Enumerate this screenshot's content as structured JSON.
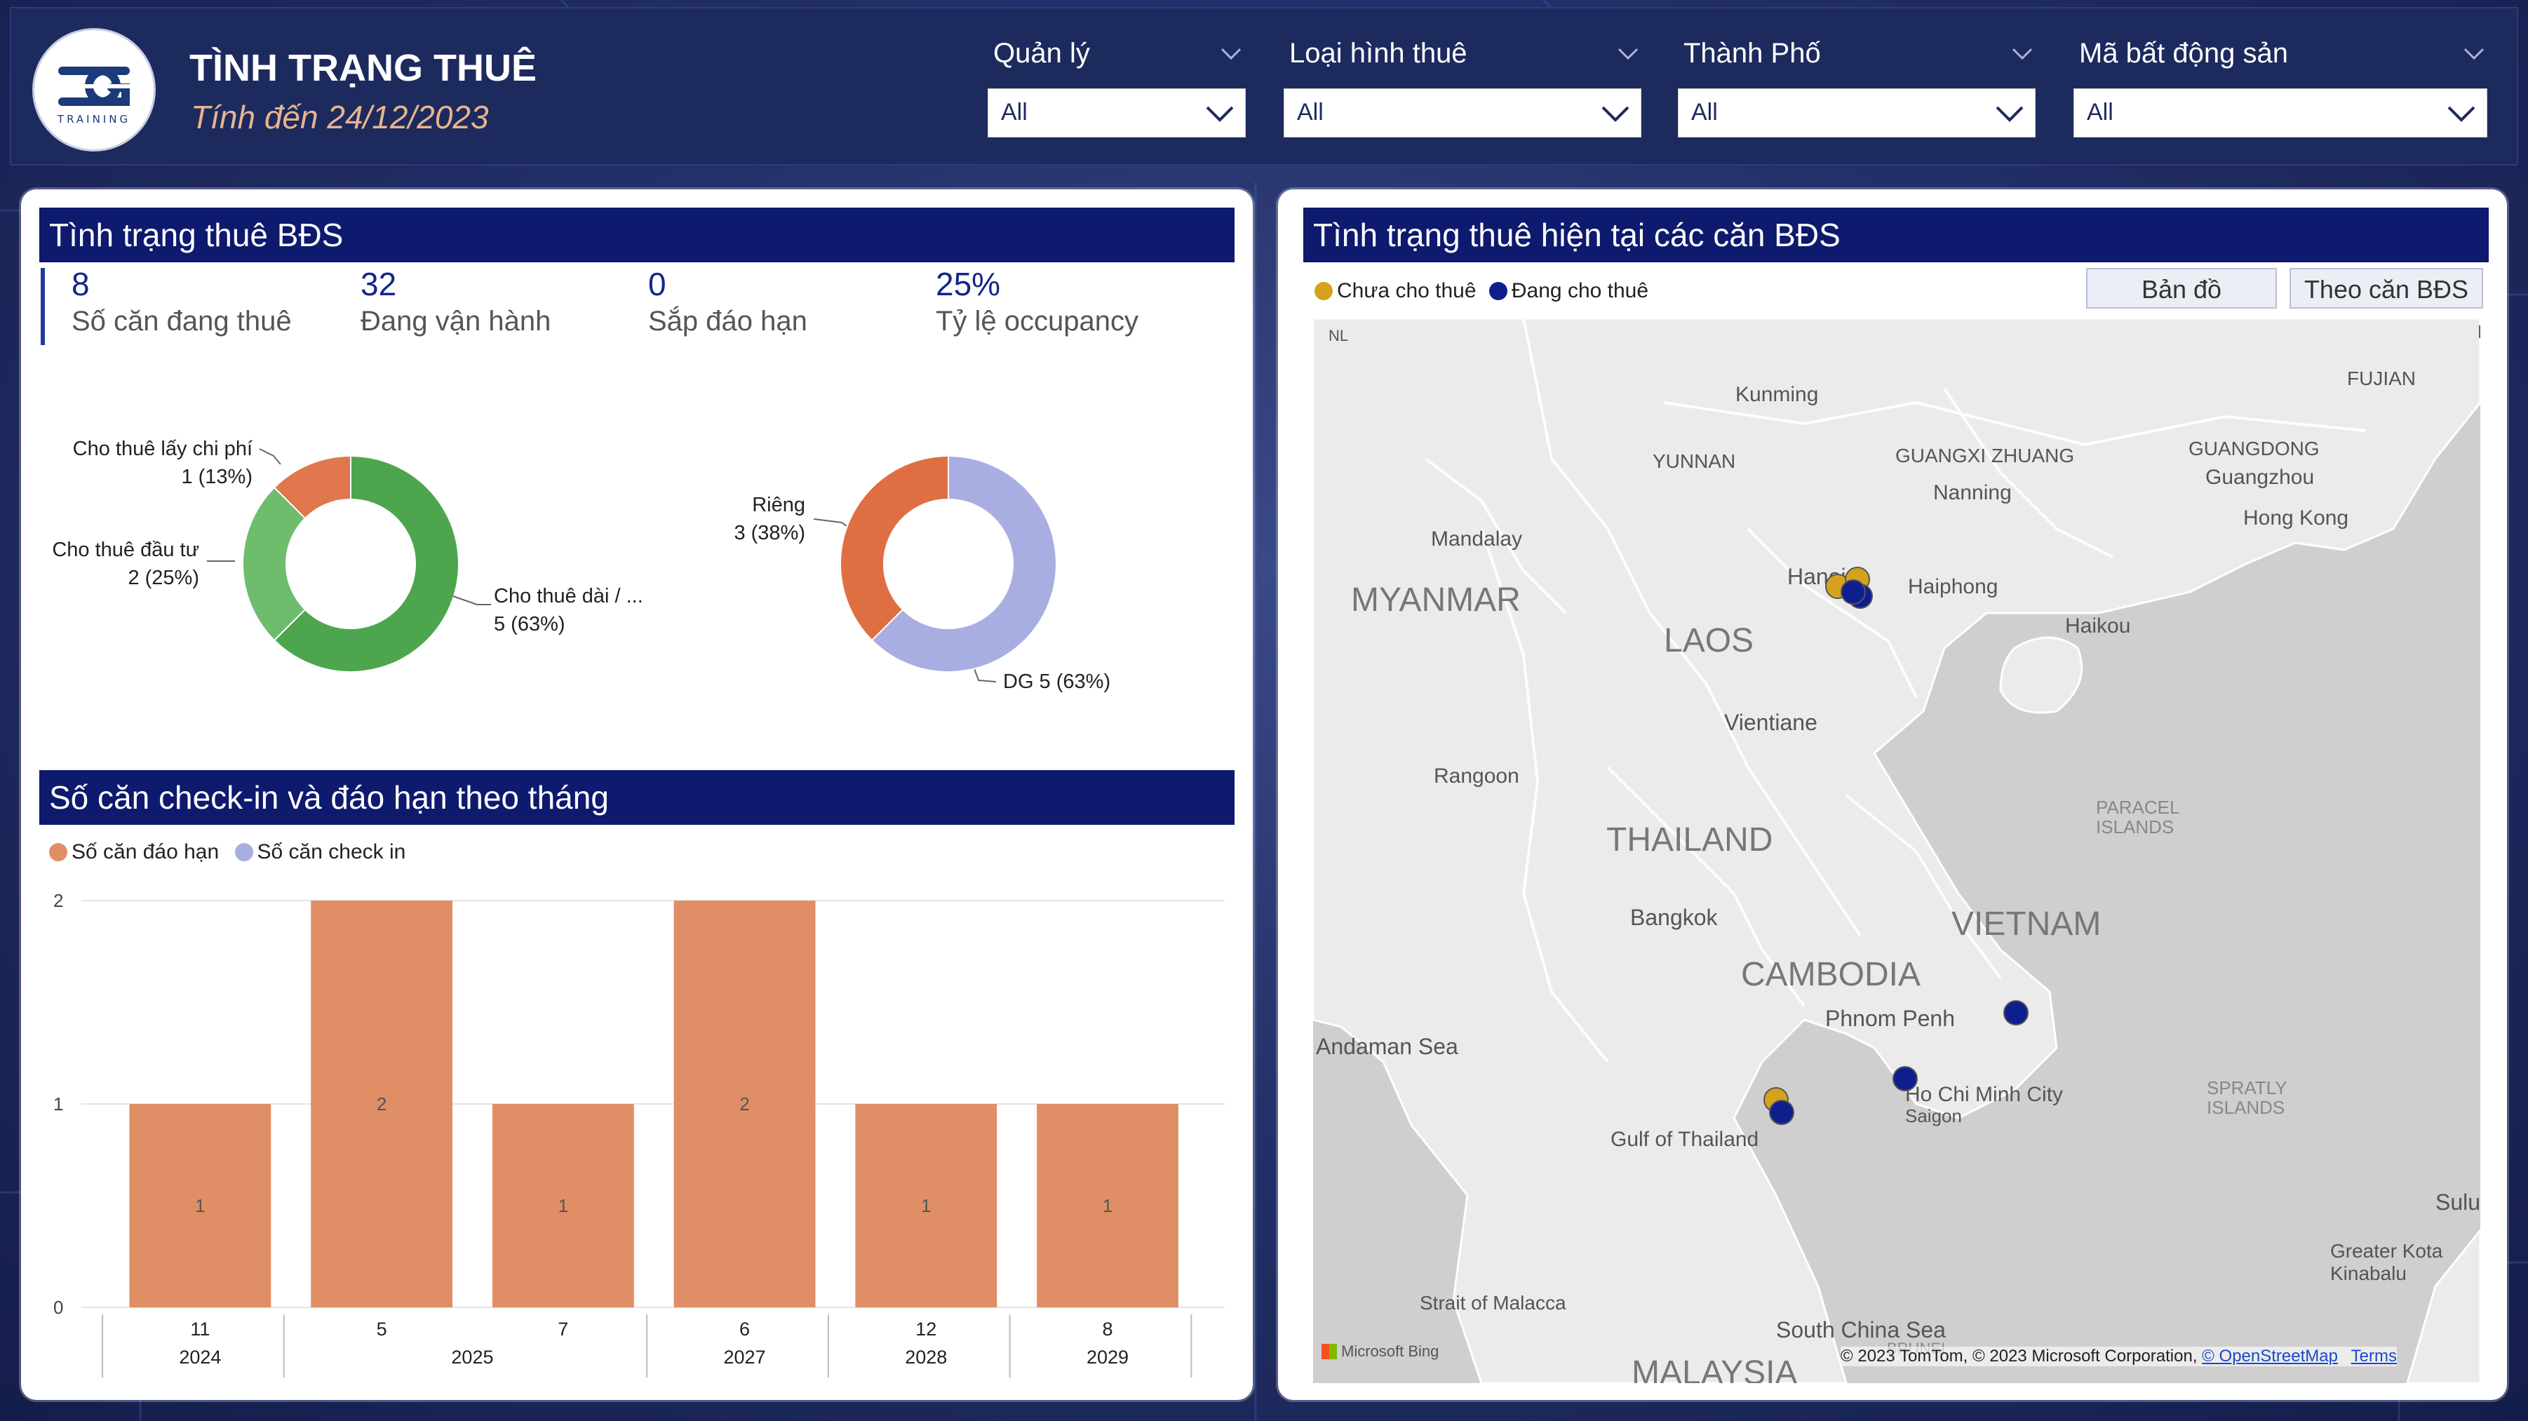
{
  "header": {
    "logo_text": "TRAINING",
    "title": "TÌNH TRẠNG THUÊ",
    "subtitle": "Tính đến 24/12/2023"
  },
  "filters": [
    {
      "label": "Quản lý",
      "value": "All"
    },
    {
      "label": "Loại hình thuê",
      "value": "All"
    },
    {
      "label": "Thành Phố",
      "value": "All"
    },
    {
      "label": "Mã bất động sản",
      "value": "All"
    }
  ],
  "status_panel": {
    "title": "Tình trạng thuê BĐS",
    "kpis": [
      {
        "value": "8",
        "label": "Số căn đang thuê"
      },
      {
        "value": "32",
        "label": "Đang vận hành"
      },
      {
        "value": "0",
        "label": "Sắp đáo hạn"
      },
      {
        "value": "25%",
        "label": "Tỷ lệ occupancy"
      }
    ],
    "donut1": {
      "slices": [
        {
          "label": "Cho thuê dài / ...",
          "value_text": "5 (63%)",
          "value": 5,
          "color": "#4da64d"
        },
        {
          "label": "Cho thuê đầu tư",
          "value_text": "2 (25%)",
          "value": 2,
          "color": "#6dbd6d"
        },
        {
          "label": "Cho thuê lấy chi phí",
          "value_text": "1 (13%)",
          "value": 1,
          "color": "#e0774d"
        }
      ]
    },
    "donut2": {
      "slices": [
        {
          "label": "DG",
          "value_text": "DG 5 (63%)",
          "value": 5,
          "color": "#a8aee2"
        },
        {
          "label": "Riêng",
          "value_text": "3 (38%)",
          "value": 3,
          "color": "#df6f42"
        }
      ]
    }
  },
  "monthly_panel": {
    "title": "Số căn check-in và đáo hạn theo tháng"
  },
  "chart_data": {
    "type": "bar",
    "title": "Số căn check-in và đáo hạn theo tháng",
    "series": [
      {
        "name": "Số căn đáo hạn",
        "color": "#e08e65",
        "values": [
          1,
          2,
          1,
          2,
          1,
          1
        ]
      },
      {
        "name": "Số căn check in",
        "color": "#a8aee2",
        "values": [
          0,
          0,
          0,
          0,
          0,
          0
        ]
      }
    ],
    "categories": [
      "11",
      "5",
      "7",
      "6",
      "12",
      "8"
    ],
    "years": [
      {
        "label": "2024",
        "span": 1
      },
      {
        "label": "2025",
        "span": 2
      },
      {
        "label": "2027",
        "span": 1
      },
      {
        "label": "2028",
        "span": 1
      },
      {
        "label": "2029",
        "span": 1
      }
    ],
    "yticks": [
      "0",
      "1",
      "2"
    ],
    "ylim": [
      0,
      2
    ],
    "grid": true,
    "legend": "top-left"
  },
  "map_panel": {
    "title": "Tình trạng thuê hiện tại các căn BĐS",
    "legend": [
      {
        "label": "Chưa cho thuê",
        "color": "#d4a21c"
      },
      {
        "label": "Đang cho thuê",
        "color": "#0f1e8f"
      }
    ],
    "buttons": [
      "Bản đồ",
      "Theo căn BĐS"
    ],
    "places": {
      "kunming": "Kunming",
      "yunnan": "YUNNAN",
      "guangxi": "GUANGXI ZHUANG",
      "nanning": "Nanning",
      "guangdong": "GUANGDONG",
      "guangzhou": "Guangzhou",
      "fujian": "FUJIAN",
      "hongkong": "Hong Kong",
      "mandalay": "Mandalay",
      "myanmar": "MYANMAR",
      "laos": "LAOS",
      "hanoi": "Hanoi",
      "haiphong": "Haiphong",
      "haikou": "Haikou",
      "vientiane": "Vientiane",
      "rangoon": "Rangoon",
      "thailand": "THAILAND",
      "paracel": "PARACEL",
      "islands1": "ISLANDS",
      "bangkok": "Bangkok",
      "vietnam": "VIETNAM",
      "cambodia": "CAMBODIA",
      "phnompenh": "Phnom Penh",
      "andaman": "Andaman Sea",
      "hcmc": "Ho Chi Minh City",
      "saigon": "Saigon",
      "spratly": "SPRATLY",
      "islands2": "ISLANDS",
      "gulf": "Gulf of Thailand",
      "sulu": "Sulu",
      "kinabalu1": "Greater Kota",
      "kinabalu2": "Kinabalu",
      "malacca": "Strait of Malacca",
      "scs": "South China Sea",
      "malaysia": "MALAYSIA",
      "brunei": "BRUNEI",
      "nl": "NL",
      "f": "F"
    },
    "attribution": "© 2023 TomTom, © 2023 Microsoft Corporation,",
    "osm": "© OpenStreetMap",
    "terms": "Terms",
    "bing": "Microsoft Bing"
  }
}
